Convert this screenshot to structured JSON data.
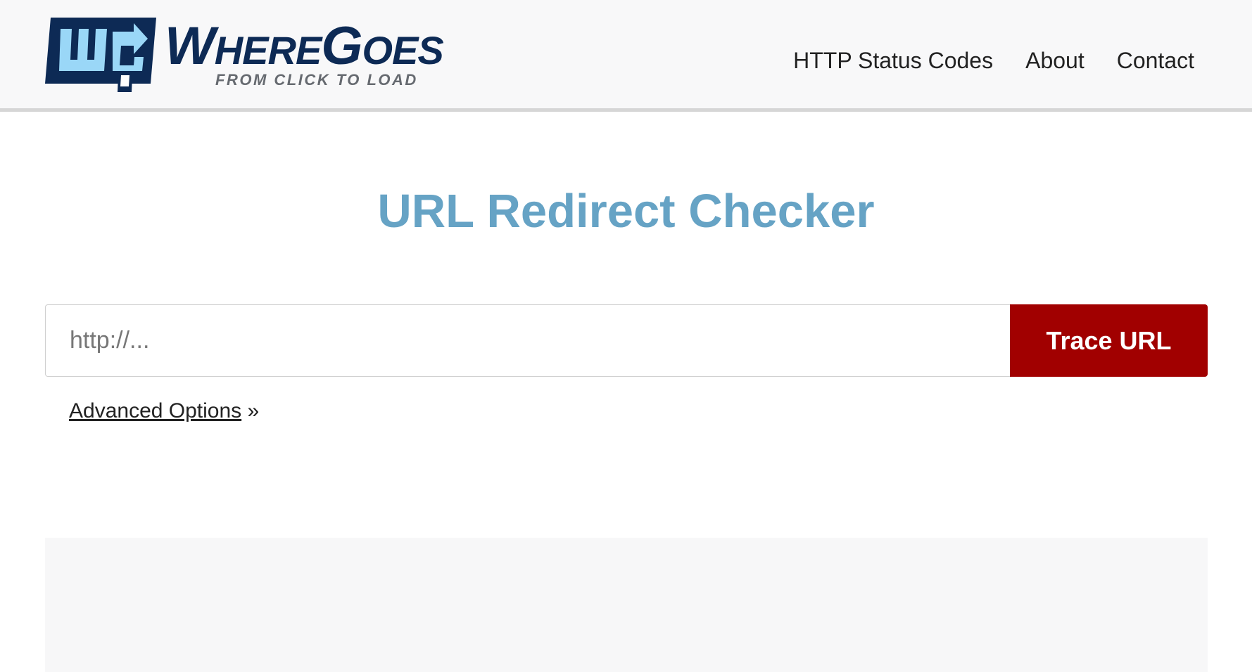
{
  "header": {
    "brand_first": "W",
    "brand_mid": "HERE",
    "brand_g": "G",
    "brand_rest": "OES",
    "tagline": "FROM CLICK TO LOAD",
    "nav": [
      {
        "label": "HTTP Status Codes"
      },
      {
        "label": "About"
      },
      {
        "label": "Contact"
      }
    ]
  },
  "main": {
    "title": "URL Redirect Checker",
    "url_input": {
      "placeholder": "http://...",
      "value": ""
    },
    "trace_button_label": "Trace URL",
    "advanced_options": {
      "label": "Advanced Options",
      "suffix": " »"
    }
  },
  "colors": {
    "title": "#66a3c5",
    "button": "#a10000",
    "brand_navy": "#0d2a55",
    "brand_light_blue": "#9ad7f7"
  },
  "icons": {
    "logo": "wheregoes-logo-icon"
  }
}
